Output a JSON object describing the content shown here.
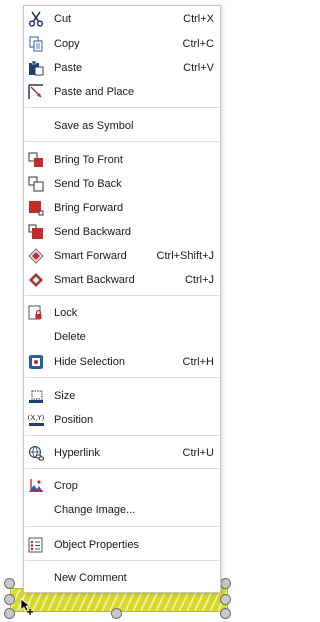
{
  "menu": {
    "cut": {
      "label": "Cut",
      "shortcut": "Ctrl+X",
      "icon": "scissors-icon"
    },
    "copy": {
      "label": "Copy",
      "shortcut": "Ctrl+C",
      "icon": "copy-icon"
    },
    "paste": {
      "label": "Paste",
      "shortcut": "Ctrl+V",
      "icon": "paste-icon"
    },
    "paste_place": {
      "label": "Paste and Place",
      "icon": "paste-place-icon"
    },
    "save_symbol": {
      "label": "Save as Symbol"
    },
    "bring_front": {
      "label": "Bring To Front",
      "icon": "bring-to-front-icon"
    },
    "send_back": {
      "label": "Send To Back",
      "icon": "send-to-back-icon"
    },
    "bring_forward": {
      "label": "Bring Forward",
      "icon": "bring-forward-icon"
    },
    "send_backward": {
      "label": "Send Backward",
      "icon": "send-backward-icon"
    },
    "smart_forward": {
      "label": "Smart Forward",
      "shortcut": "Ctrl+Shift+J",
      "icon": "smart-forward-icon"
    },
    "smart_backward": {
      "label": "Smart Backward",
      "shortcut": "Ctrl+J",
      "icon": "smart-backward-icon"
    },
    "lock": {
      "label": "Lock",
      "icon": "lock-icon"
    },
    "delete": {
      "label": "Delete"
    },
    "hide_selection": {
      "label": "Hide Selection",
      "shortcut": "Ctrl+H",
      "icon": "hide-selection-icon"
    },
    "size": {
      "label": "Size",
      "icon": "size-icon"
    },
    "position": {
      "label": "Position",
      "icon": "position-icon",
      "icon_text": "(X,Y)"
    },
    "hyperlink": {
      "label": "Hyperlink",
      "shortcut": "Ctrl+U",
      "icon": "hyperlink-icon"
    },
    "crop": {
      "label": "Crop",
      "icon": "crop-icon"
    },
    "change_image": {
      "label": "Change Image..."
    },
    "object_properties": {
      "label": "Object Properties",
      "icon": "object-properties-icon"
    },
    "new_comment": {
      "label": "New Comment"
    }
  },
  "colors": {
    "accent_red": "#c42b2b",
    "accent_blue": "#1f5fa8",
    "shape_fill": "#d8d82a"
  }
}
